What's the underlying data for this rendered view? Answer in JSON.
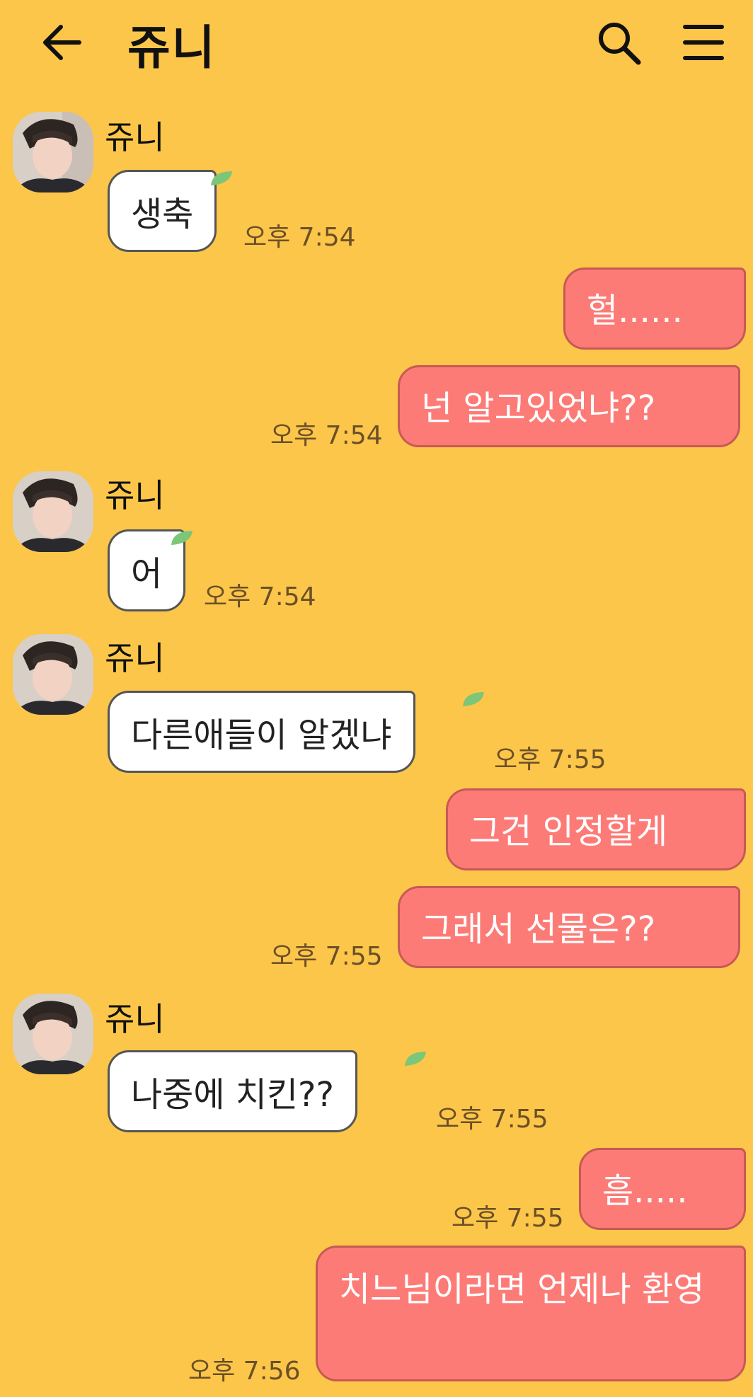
{
  "header": {
    "title": "쥬니"
  },
  "messages": [
    {
      "sender": "쥬니",
      "text": "생축",
      "time": "오후 7:54"
    },
    {
      "text": "헐......"
    },
    {
      "text": "넌 알고있었냐??",
      "time": "오후 7:54"
    },
    {
      "sender": "쥬니",
      "text": "어",
      "time": "오후 7:54"
    },
    {
      "sender": "쥬니",
      "text": "다른애들이 알겠냐",
      "time": "오후 7:55"
    },
    {
      "text": "그건 인정할게"
    },
    {
      "text": "그래서 선물은??",
      "time": "오후 7:55"
    },
    {
      "sender": "쥬니",
      "text": "나중에 치킨??",
      "time": "오후 7:55"
    },
    {
      "text": "흠.....",
      "time": "오후 7:55"
    },
    {
      "text": "치느님이라면 언제나 환영",
      "time": "오후 7:56"
    }
  ],
  "colors": {
    "background": "#fcc64a",
    "outgoing_bubble": "#fd7b77",
    "incoming_bubble": "#ffffff",
    "timestamp": "#6b4f27"
  }
}
